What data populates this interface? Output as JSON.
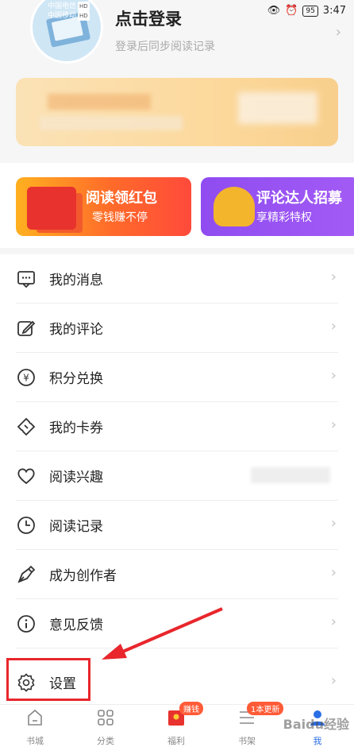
{
  "status_bar": {
    "carrier1": "中国电信",
    "carrier2": "中国移动",
    "hd": "HD",
    "battery": "95",
    "time": "3:47"
  },
  "profile": {
    "login_title": "点击登录",
    "login_subtitle": "登录后同步阅读记录"
  },
  "banners": [
    {
      "title": "阅读领红包",
      "subtitle": "零钱赚不停"
    },
    {
      "title": "评论达人招募",
      "subtitle": "享精彩特权"
    }
  ],
  "menu": [
    {
      "label": "我的消息",
      "icon": "message-icon"
    },
    {
      "label": "我的评论",
      "icon": "edit-icon"
    },
    {
      "label": "积分兑换",
      "icon": "yen-coin-icon"
    },
    {
      "label": "我的卡券",
      "icon": "ticket-icon"
    },
    {
      "label": "阅读兴趣",
      "icon": "heart-icon"
    },
    {
      "label": "阅读记录",
      "icon": "clock-icon"
    },
    {
      "label": "成为创作者",
      "icon": "pen-nib-icon"
    },
    {
      "label": "意见反馈",
      "icon": "info-icon"
    },
    {
      "label": "设置",
      "icon": "gear-icon"
    }
  ],
  "tabbar": [
    {
      "label": "书城",
      "icon": "home-icon"
    },
    {
      "label": "分类",
      "icon": "grid-icon"
    },
    {
      "label": "福利",
      "icon": "gift-icon",
      "badge": "赚钱"
    },
    {
      "label": "书架",
      "icon": "bookshelf-icon",
      "badge": "1本更新"
    },
    {
      "label": "我",
      "icon": "user-icon",
      "active": true
    }
  ],
  "colors": {
    "accent_blue": "#2b6fe6",
    "highlight_red": "#e8262c"
  },
  "watermark": "Baidu经验"
}
